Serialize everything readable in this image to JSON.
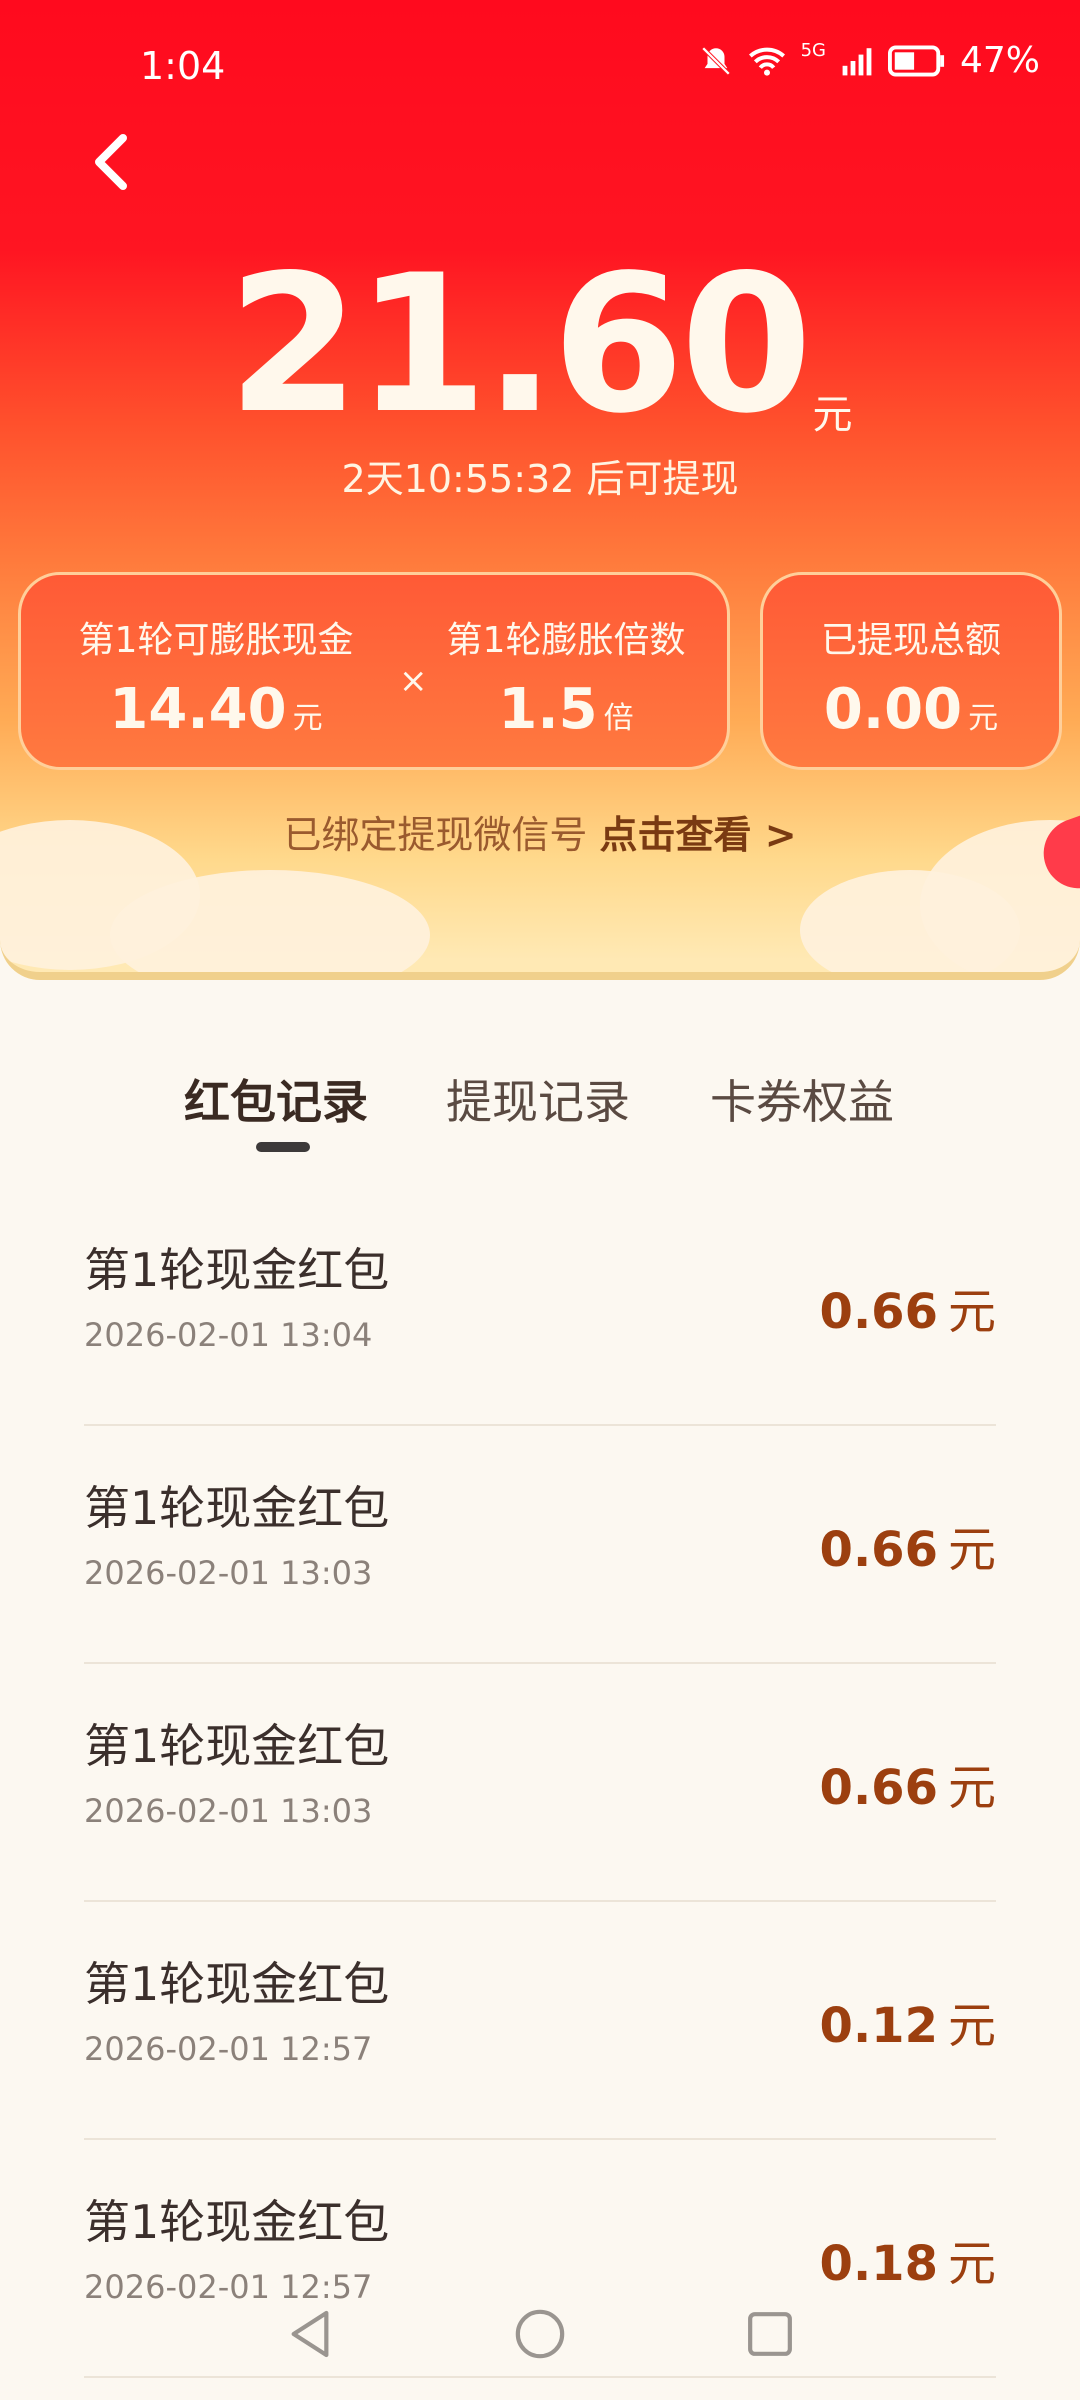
{
  "status_bar": {
    "time": "1:04",
    "network": "5G",
    "battery": "47%"
  },
  "balance": {
    "amount": "21.60",
    "unit": "元",
    "countdown": "2天10:55:32 后可提现"
  },
  "inflation": {
    "cash_label": "第1轮可膨胀现金",
    "cash_value": "14.40",
    "cash_unit": "元",
    "times_sign": "×",
    "multiplier_label": "第1轮膨胀倍数",
    "multiplier_value": "1.5",
    "multiplier_unit": "倍",
    "withdrawn_label": "已提现总额",
    "withdrawn_value": "0.00",
    "withdrawn_unit": "元"
  },
  "wechat_bind": {
    "text": "已绑定提现微信号",
    "link": "点击查看 >"
  },
  "tabs": [
    {
      "label": "红包记录",
      "active": true
    },
    {
      "label": "提现记录",
      "active": false
    },
    {
      "label": "卡券权益",
      "active": false
    }
  ],
  "records": [
    {
      "title": "第1轮现金红包",
      "time": "2026-02-01 13:04",
      "amount": "0.66",
      "unit": "元"
    },
    {
      "title": "第1轮现金红包",
      "time": "2026-02-01 13:03",
      "amount": "0.66",
      "unit": "元"
    },
    {
      "title": "第1轮现金红包",
      "time": "2026-02-01 13:03",
      "amount": "0.66",
      "unit": "元"
    },
    {
      "title": "第1轮现金红包",
      "time": "2026-02-01 12:57",
      "amount": "0.12",
      "unit": "元"
    },
    {
      "title": "第1轮现金红包",
      "time": "2026-02-01 12:57",
      "amount": "0.18",
      "unit": "元"
    }
  ],
  "colors": {
    "header_red": "#ff0a1e",
    "amount_brown": "#9c3f0f",
    "background": "#fcf8f1"
  }
}
